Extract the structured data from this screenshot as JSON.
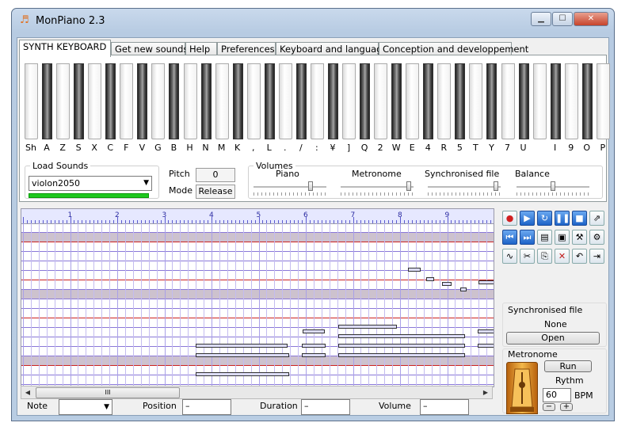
{
  "window": {
    "title": "MonPiano 2.3",
    "app_icon": "music-note-icon",
    "min": "▁",
    "max": "☐",
    "close": "✕"
  },
  "tabs": [
    "SYNTH KEYBOARD",
    "Get new sounds",
    "Help",
    "Preferences",
    "Keyboard and language",
    "Conception and developpement"
  ],
  "keyboard": {
    "labels": [
      "Sh",
      "A",
      "Z",
      "S",
      "X",
      "C",
      "F",
      "V",
      "G",
      "B",
      "H",
      "N",
      "M",
      "K",
      ",",
      "L",
      ".",
      "/",
      ":",
      "¥",
      "]",
      "Q",
      "2",
      "W",
      "E",
      "4",
      "R",
      "5",
      "T",
      "Y",
      "7",
      "U",
      "",
      "I",
      "9",
      "O",
      "P"
    ]
  },
  "load_sounds": {
    "legend": "Load Sounds",
    "selected": "violon2050"
  },
  "pitch": {
    "label": "Pitch",
    "value": "0"
  },
  "mode": {
    "label": "Mode",
    "value": "Release"
  },
  "volumes": {
    "legend": "Volumes",
    "sliders": [
      {
        "label": "Piano",
        "level": 0.8
      },
      {
        "label": "Metronome",
        "level": 0.97
      },
      {
        "label": "Synchronised file",
        "level": 0.97
      },
      {
        "label": "Balance",
        "level": 0.5
      }
    ]
  },
  "ruler": {
    "numbers": [
      "1",
      "2",
      "3",
      "4",
      "5",
      "6",
      "7",
      "8",
      "9"
    ]
  },
  "toolbar": {
    "row1": [
      "record-icon",
      "play-icon",
      "loop-icon",
      "pause-icon",
      "stop-icon",
      "export-icon"
    ],
    "row2": [
      "to-start-icon",
      "to-end-icon",
      "open-folder-icon",
      "save-icon",
      "tools-icon",
      "wrench-icon"
    ],
    "row3": [
      "waveform-icon",
      "cut-icon",
      "paste-icon",
      "delete-icon",
      "undo-icon",
      "insert-icon"
    ]
  },
  "synchronised_file": {
    "title": "Synchronised file",
    "value": "None",
    "open_label": "Open"
  },
  "metronome": {
    "title": "Metronome",
    "run_label": "Run",
    "rythm_label": "Rythm",
    "bpm_value": "60",
    "bpm_unit": "BPM",
    "minus": "−",
    "plus": "+"
  },
  "bottom": {
    "note_label": "Note",
    "note_value": "",
    "position_label": "Position",
    "position_value": "–",
    "duration_label": "Duration",
    "duration_value": "–",
    "volume_label": "Volume",
    "volume_value": "–"
  },
  "scroll_thumb_glyph": "III",
  "colors": {
    "progress": "#1ec81e",
    "ruler_numbers": "#2a2aa0",
    "record": "#d02020"
  }
}
